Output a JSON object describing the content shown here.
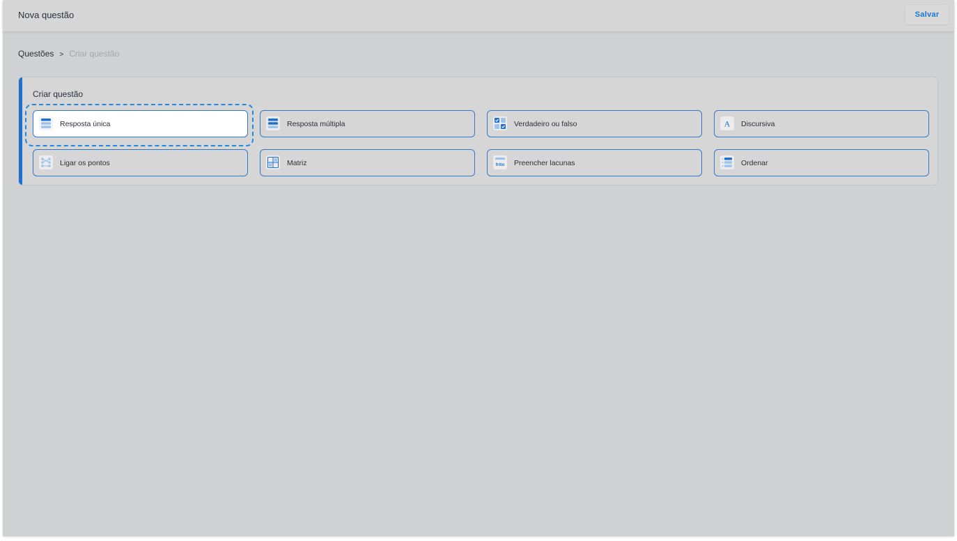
{
  "header": {
    "title": "Nova questão",
    "save_label": "Salvar"
  },
  "breadcrumb": {
    "parent": "Questões",
    "separator": ">",
    "current": "Criar questão"
  },
  "create_card": {
    "title": "Criar questão",
    "options": [
      {
        "label": "Resposta única",
        "icon": "single-answer-icon",
        "selected": true
      },
      {
        "label": "Resposta múltipla",
        "icon": "multiple-answer-icon",
        "selected": false
      },
      {
        "label": "Verdadeiro ou falso",
        "icon": "true-false-icon",
        "selected": false
      },
      {
        "label": "Discursiva",
        "icon": "essay-icon",
        "selected": false
      },
      {
        "label": "Ligar os pontos",
        "icon": "connect-dots-icon",
        "selected": false
      },
      {
        "label": "Matriz",
        "icon": "matrix-icon",
        "selected": false
      },
      {
        "label": "Preencher lacunas",
        "icon": "fill-blanks-icon",
        "selected": false
      },
      {
        "label": "Ordenar",
        "icon": "ordering-icon",
        "selected": false
      }
    ]
  },
  "colors": {
    "accent": "#1e6fcf",
    "focus": "#1e88e5",
    "background": "#d0d1d3"
  }
}
